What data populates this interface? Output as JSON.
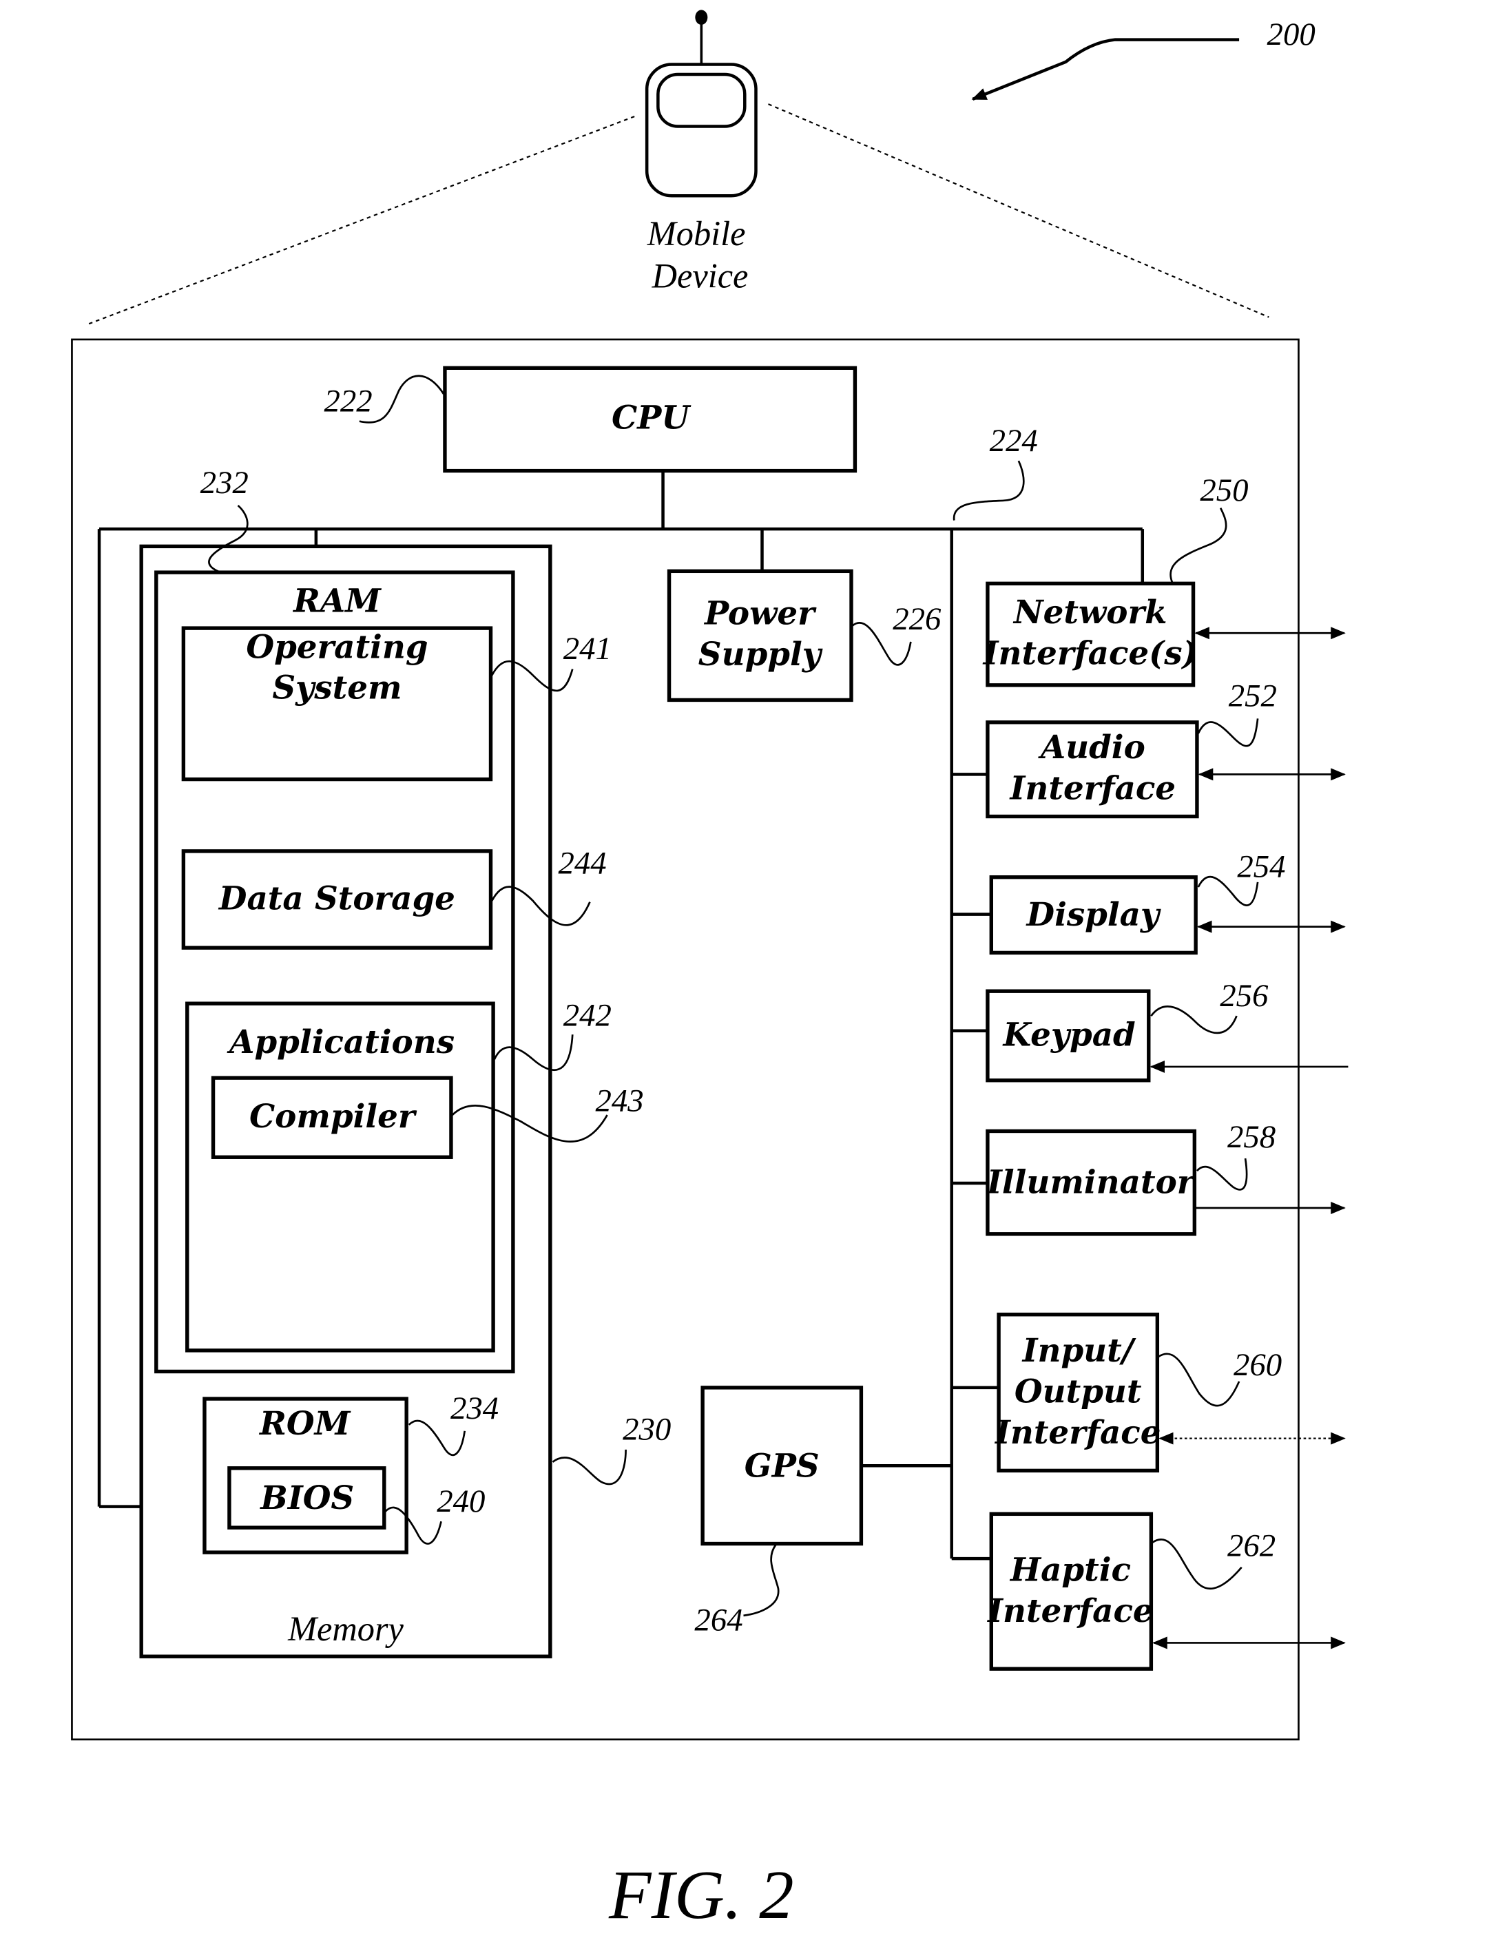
{
  "figure": {
    "number_ref": "200",
    "caption": "FIG. 2",
    "device_label_line1": "Mobile",
    "device_label_line2": "Device"
  },
  "components": {
    "cpu": {
      "label": "CPU",
      "ref": "222"
    },
    "bus": {
      "ref": "224"
    },
    "power_supply": {
      "label_line1": "Power",
      "label_line2": "Supply",
      "ref": "226"
    },
    "memory": {
      "label": "Memory",
      "ref": "230"
    },
    "ram": {
      "label": "RAM",
      "ref": "232"
    },
    "rom": {
      "label": "ROM",
      "ref": "234"
    },
    "bios": {
      "label": "BIOS",
      "ref": "240"
    },
    "operating_system": {
      "label_line1": "Operating",
      "label_line2": "System",
      "ref": "241"
    },
    "applications": {
      "label": "Applications",
      "ref": "242"
    },
    "compiler": {
      "label": "Compiler",
      "ref": "243"
    },
    "data_storage": {
      "label": "Data Storage",
      "ref": "244"
    },
    "network_interface": {
      "label_line1": "Network",
      "label_line2": "Interface(s)",
      "ref": "250"
    },
    "audio_interface": {
      "label_line1": "Audio",
      "label_line2": "Interface",
      "ref": "252"
    },
    "display": {
      "label": "Display",
      "ref": "254"
    },
    "keypad": {
      "label": "Keypad",
      "ref": "256"
    },
    "illuminator": {
      "label": "Illuminator",
      "ref": "258"
    },
    "io_interface": {
      "label_line1": "Input/",
      "label_line2": "Output",
      "label_line3": "Interface",
      "ref": "260"
    },
    "haptic_interface": {
      "label_line1": "Haptic",
      "label_line2": "Interface",
      "ref": "262"
    },
    "gps": {
      "label": "GPS",
      "ref": "264"
    }
  }
}
